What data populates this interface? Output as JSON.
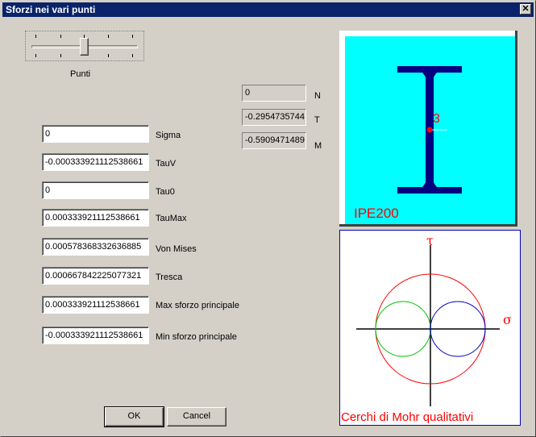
{
  "window": {
    "title": "Sforzi nei vari punti",
    "close_glyph": "✕"
  },
  "slider": {
    "label": "Punti"
  },
  "fields": {
    "sigma": {
      "value": "0",
      "label": "Sigma"
    },
    "tauv": {
      "value": "-0.000333921112538661",
      "label": "TauV"
    },
    "tau0": {
      "value": "0",
      "label": "Tau0"
    },
    "taumax": {
      "value": "0.000333921112538661",
      "label": "TauMax"
    },
    "vonmises": {
      "value": "0.000578368332636885",
      "label": "Von Mises"
    },
    "tresca": {
      "value": "0.000667842225077321",
      "label": "Tresca"
    },
    "maxp": {
      "value": "0.000333921112538661",
      "label": "Max sforzo principale"
    },
    "minp": {
      "value": "-0.000333921112538661",
      "label": "Min sforzo principale"
    }
  },
  "readouts": {
    "n": {
      "value": "0",
      "label": "N"
    },
    "t": {
      "value": "-0.2954735744",
      "label": "T"
    },
    "m": {
      "value": "-0.5909471489",
      "label": "M"
    }
  },
  "section": {
    "name": "IPE200",
    "point_label": "3",
    "background": "#00ffff",
    "beam_color": "#000080",
    "accent": "#ff0000"
  },
  "mohr": {
    "caption": "Cerchi di Mohr qualitativi",
    "tau_label": "τ",
    "sigma_label": "σ",
    "colors": {
      "big": "#ff0000",
      "left": "#00c000",
      "right": "#0000c0"
    }
  },
  "buttons": {
    "ok": "OK",
    "cancel": "Cancel"
  }
}
